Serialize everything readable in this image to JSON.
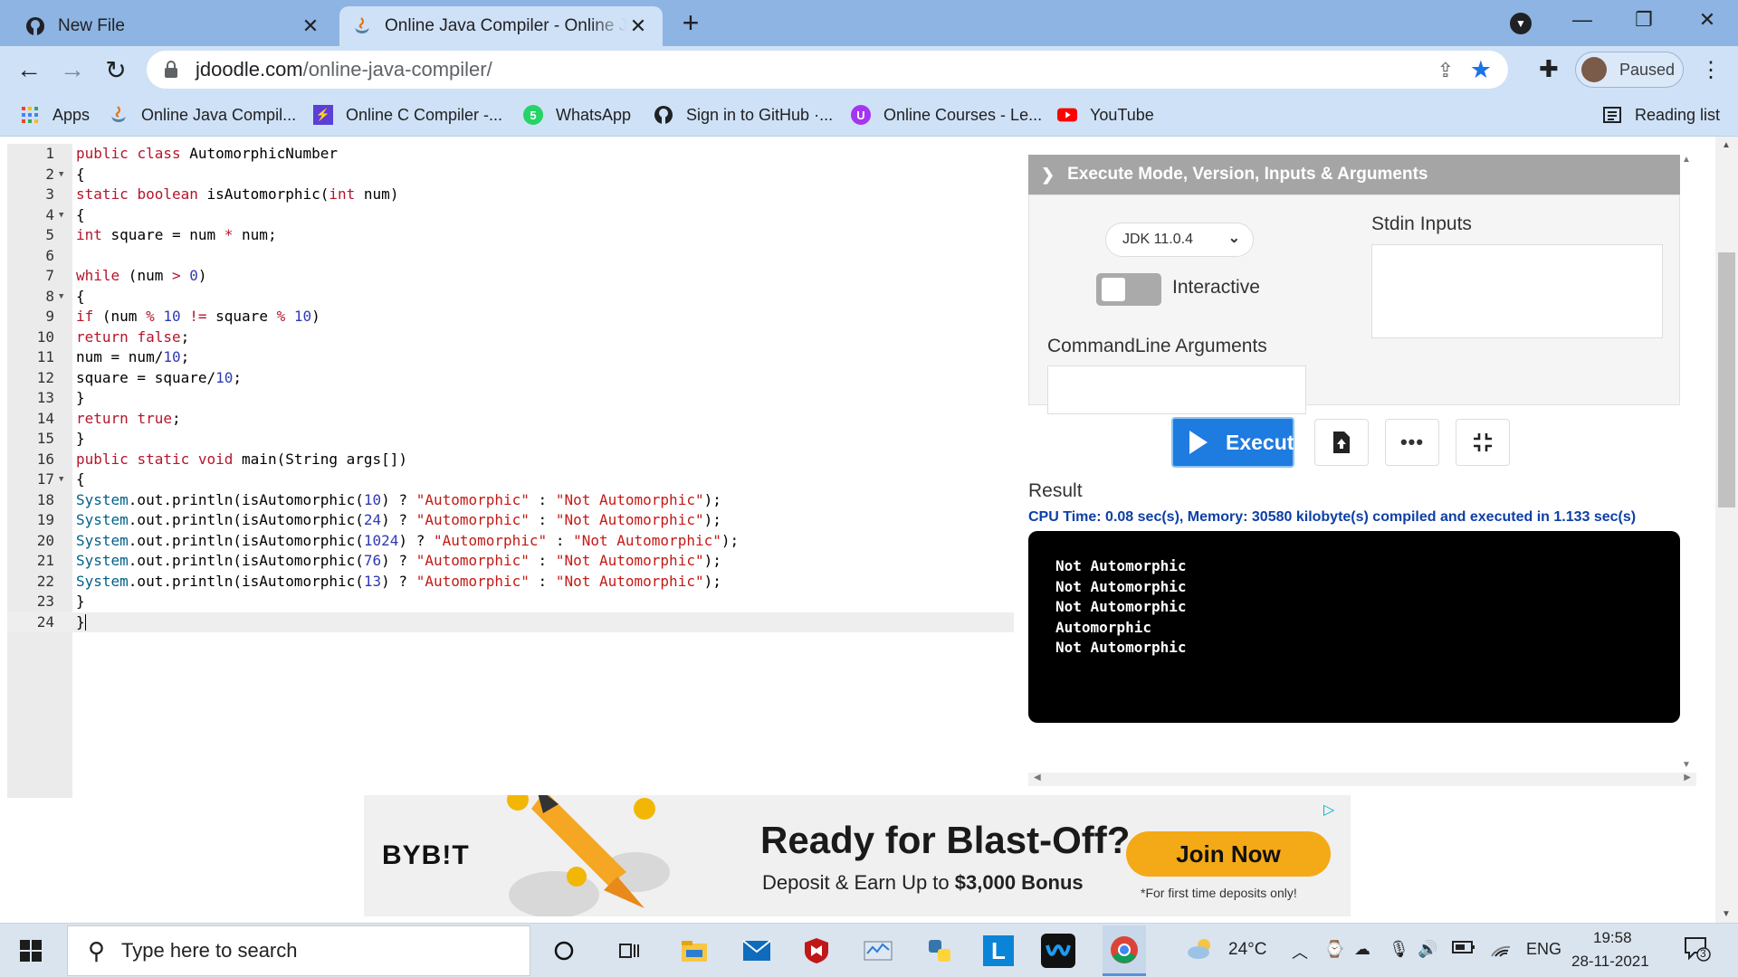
{
  "browser": {
    "tabs": [
      {
        "title": "New File",
        "favicon": "github-icon"
      },
      {
        "title": "Online Java Compiler - Online Java Editor",
        "favicon": "java-icon"
      }
    ],
    "new_tab_symbol": "+",
    "url_host": "jdoodle.com",
    "url_path": "/online-java-compiler/",
    "profile_label": "Paused",
    "bookmarks": [
      {
        "label": "Apps",
        "icon": "apps-grid-icon"
      },
      {
        "label": "Online Java Compil...",
        "icon": "java-icon"
      },
      {
        "label": "Online C Compiler -...",
        "icon": "bolt-icon"
      },
      {
        "label": "WhatsApp",
        "icon": "whatsapp-icon",
        "badge": "5"
      },
      {
        "label": "Sign in to GitHub ·...",
        "icon": "github-icon"
      },
      {
        "label": "Online Courses - Le...",
        "icon": "udemy-icon"
      },
      {
        "label": "YouTube",
        "icon": "youtube-icon"
      }
    ],
    "reading_list": "Reading list"
  },
  "editor": {
    "lines": [
      {
        "n": "1",
        "fold": false,
        "tokens": [
          [
            "kw",
            "public"
          ],
          [
            "t",
            " "
          ],
          [
            "kw",
            "class"
          ],
          [
            "t",
            " AutomorphicNumber"
          ]
        ]
      },
      {
        "n": "2",
        "fold": true,
        "tokens": [
          [
            "t",
            "{"
          ]
        ]
      },
      {
        "n": "3",
        "fold": false,
        "tokens": [
          [
            "kw",
            "static"
          ],
          [
            "t",
            " "
          ],
          [
            "kw",
            "boolean"
          ],
          [
            "t",
            " isAutomorphic("
          ],
          [
            "kw",
            "int"
          ],
          [
            "t",
            " num)"
          ]
        ]
      },
      {
        "n": "4",
        "fold": true,
        "tokens": [
          [
            "t",
            "{"
          ]
        ]
      },
      {
        "n": "5",
        "fold": false,
        "tokens": [
          [
            "kw",
            "int"
          ],
          [
            "t",
            " square = num "
          ],
          [
            "op",
            "*"
          ],
          [
            "t",
            " num;"
          ]
        ]
      },
      {
        "n": "6",
        "fold": false,
        "tokens": []
      },
      {
        "n": "7",
        "fold": false,
        "tokens": [
          [
            "kw",
            "while"
          ],
          [
            "t",
            " (num "
          ],
          [
            "op",
            ">"
          ],
          [
            "t",
            " "
          ],
          [
            "nu",
            "0"
          ],
          [
            "t",
            ")"
          ]
        ]
      },
      {
        "n": "8",
        "fold": true,
        "tokens": [
          [
            "t",
            "{"
          ]
        ]
      },
      {
        "n": "9",
        "fold": false,
        "tokens": [
          [
            "kw",
            "if"
          ],
          [
            "t",
            " (num "
          ],
          [
            "op",
            "%"
          ],
          [
            "t",
            " "
          ],
          [
            "nu",
            "10"
          ],
          [
            "t",
            " "
          ],
          [
            "op",
            "!="
          ],
          [
            "t",
            " square "
          ],
          [
            "op",
            "%"
          ],
          [
            "t",
            " "
          ],
          [
            "nu",
            "10"
          ],
          [
            "t",
            ")"
          ]
        ]
      },
      {
        "n": "10",
        "fold": false,
        "tokens": [
          [
            "kw",
            "return"
          ],
          [
            "t",
            " "
          ],
          [
            "kw",
            "false"
          ],
          [
            "t",
            ";"
          ]
        ]
      },
      {
        "n": "11",
        "fold": false,
        "tokens": [
          [
            "t",
            "num = num/"
          ],
          [
            "nu",
            "10"
          ],
          [
            "t",
            ";"
          ]
        ]
      },
      {
        "n": "12",
        "fold": false,
        "tokens": [
          [
            "t",
            "square = square/"
          ],
          [
            "nu",
            "10"
          ],
          [
            "t",
            ";"
          ]
        ]
      },
      {
        "n": "13",
        "fold": false,
        "tokens": [
          [
            "t",
            "}"
          ]
        ]
      },
      {
        "n": "14",
        "fold": false,
        "tokens": [
          [
            "kw",
            "return"
          ],
          [
            "t",
            " "
          ],
          [
            "kw",
            "true"
          ],
          [
            "t",
            ";"
          ]
        ]
      },
      {
        "n": "15",
        "fold": false,
        "tokens": [
          [
            "t",
            "}"
          ]
        ]
      },
      {
        "n": "16",
        "fold": false,
        "tokens": [
          [
            "kw",
            "public"
          ],
          [
            "t",
            " "
          ],
          [
            "kw",
            "static"
          ],
          [
            "t",
            " "
          ],
          [
            "kw",
            "void"
          ],
          [
            "t",
            " main(String args[])"
          ]
        ]
      },
      {
        "n": "17",
        "fold": true,
        "tokens": [
          [
            "t",
            "{"
          ]
        ]
      },
      {
        "n": "18",
        "fold": false,
        "tokens": [
          [
            "cls",
            "System"
          ],
          [
            "t",
            ".out.println(isAutomorphic("
          ],
          [
            "nu",
            "10"
          ],
          [
            "t",
            ") ? "
          ],
          [
            "st",
            "\"Automorphic\""
          ],
          [
            "t",
            " : "
          ],
          [
            "st",
            "\"Not Automorphic\""
          ],
          [
            "t",
            ");"
          ]
        ]
      },
      {
        "n": "19",
        "fold": false,
        "tokens": [
          [
            "cls",
            "System"
          ],
          [
            "t",
            ".out.println(isAutomorphic("
          ],
          [
            "nu",
            "24"
          ],
          [
            "t",
            ") ? "
          ],
          [
            "st",
            "\"Automorphic\""
          ],
          [
            "t",
            " : "
          ],
          [
            "st",
            "\"Not Automorphic\""
          ],
          [
            "t",
            ");"
          ]
        ]
      },
      {
        "n": "20",
        "fold": false,
        "tokens": [
          [
            "cls",
            "System"
          ],
          [
            "t",
            ".out.println(isAutomorphic("
          ],
          [
            "nu",
            "1024"
          ],
          [
            "t",
            ") ? "
          ],
          [
            "st",
            "\"Automorphic\""
          ],
          [
            "t",
            " : "
          ],
          [
            "st",
            "\"Not Automorphic\""
          ],
          [
            "t",
            ");"
          ]
        ]
      },
      {
        "n": "21",
        "fold": false,
        "tokens": [
          [
            "cls",
            "System"
          ],
          [
            "t",
            ".out.println(isAutomorphic("
          ],
          [
            "nu",
            "76"
          ],
          [
            "t",
            ") ? "
          ],
          [
            "st",
            "\"Automorphic\""
          ],
          [
            "t",
            " : "
          ],
          [
            "st",
            "\"Not Automorphic\""
          ],
          [
            "t",
            ");"
          ]
        ]
      },
      {
        "n": "22",
        "fold": false,
        "tokens": [
          [
            "cls",
            "System"
          ],
          [
            "t",
            ".out.println(isAutomorphic("
          ],
          [
            "nu",
            "13"
          ],
          [
            "t",
            ") ? "
          ],
          [
            "st",
            "\"Automorphic\""
          ],
          [
            "t",
            " : "
          ],
          [
            "st",
            "\"Not Automorphic\""
          ],
          [
            "t",
            ");"
          ]
        ]
      },
      {
        "n": "23",
        "fold": false,
        "tokens": [
          [
            "t",
            "}"
          ]
        ]
      },
      {
        "n": "24",
        "fold": false,
        "active": true,
        "tokens": [
          [
            "t",
            "}"
          ]
        ]
      }
    ]
  },
  "panel": {
    "header": "Execute Mode, Version, Inputs & Arguments",
    "jdk_version": "JDK 11.0.4",
    "interactive_label": "Interactive",
    "interactive_on": false,
    "stdin_label": "Stdin Inputs",
    "cmd_label": "CommandLine Arguments",
    "execute_label": "Execute",
    "result_label": "Result",
    "stats": "CPU Time: 0.08 sec(s), Memory: 30580 kilobyte(s) compiled and executed in 1.133 sec(s)",
    "output": [
      "Not Automorphic",
      "Not Automorphic",
      "Not Automorphic",
      "Automorphic",
      "Not Automorphic"
    ]
  },
  "ad": {
    "brand": "BYB!T",
    "headline": "Ready for Blast-Off?",
    "sub_prefix": "Deposit & Earn Up to ",
    "sub_bold": "$3,000 Bonus",
    "cta": "Join Now",
    "note": "*For first time deposits only!"
  },
  "taskbar": {
    "search_placeholder": "Type here to search",
    "temperature": "24°C",
    "language": "ENG",
    "time": "19:58",
    "date": "28-11-2021",
    "notification_count": "3"
  },
  "colors": {
    "execute_blue": "#1e7bdf",
    "stats_blue": "#0d3fa6",
    "ad_orange": "#f4a917"
  }
}
